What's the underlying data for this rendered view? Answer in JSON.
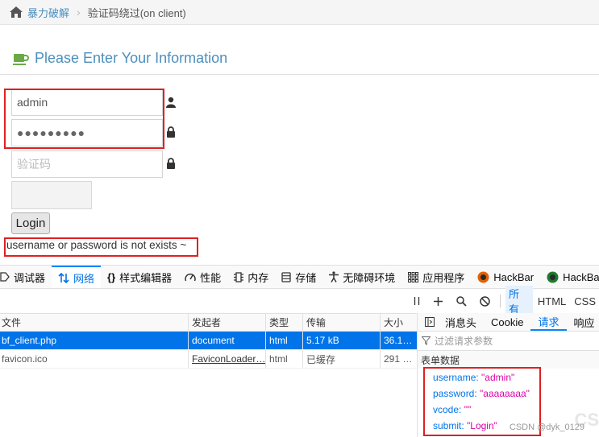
{
  "breadcrumb": {
    "home": "暴力破解",
    "current": "验证码绕过(on client)"
  },
  "form": {
    "title": "Please Enter Your Information",
    "username_value": "admin",
    "password_value": "●●●●●●●●●",
    "vcode_placeholder": "验证码",
    "login_label": "Login",
    "message": "username or password is not exists ~"
  },
  "devtools": {
    "tabs": [
      {
        "label": "调试器",
        "icon": "debugger-icon"
      },
      {
        "label": "网络",
        "icon": "network-icon",
        "active": true
      },
      {
        "label": "样式编辑器",
        "icon": "style-editor-icon"
      },
      {
        "label": "性能",
        "icon": "performance-icon"
      },
      {
        "label": "内存",
        "icon": "memory-icon"
      },
      {
        "label": "存储",
        "icon": "storage-icon"
      },
      {
        "label": "无障碍环境",
        "icon": "accessibility-icon"
      },
      {
        "label": "应用程序",
        "icon": "application-icon"
      },
      {
        "label": "HackBar",
        "icon": "hackbar-icon"
      },
      {
        "label": "HackBar",
        "icon": "hackbar-icon"
      }
    ],
    "filters": {
      "all": "所有",
      "html": "HTML",
      "css": "CSS"
    },
    "columns": [
      "文件",
      "发起者",
      "类型",
      "传输",
      "大小"
    ],
    "requests": [
      {
        "file": "bf_client.php",
        "initiator": "document",
        "type": "html",
        "transfer": "5.17 kB",
        "size": "36.1…",
        "selected": true
      },
      {
        "file": "favicon.ico",
        "initiator": "FaviconLoader…",
        "type": "html",
        "transfer": "已缓存",
        "size": "291 …",
        "selected": false
      }
    ],
    "panel_tabs": {
      "headers": "消息头",
      "cookie": "Cookie",
      "request": "请求",
      "response": "响应"
    },
    "filter_params_placeholder": "过滤请求参数",
    "form_data_label": "表单数据",
    "form_data": [
      {
        "key": "username",
        "value": "\"admin\""
      },
      {
        "key": "password",
        "value": "\"aaaaaaaa\""
      },
      {
        "key": "vcode",
        "value": "\"\""
      },
      {
        "key": "submit",
        "value": "\"Login\""
      }
    ]
  },
  "watermark": "CSDN @dyk_0129",
  "ghost_text": "CS",
  "colors": {
    "link_blue": "#4c8fbd",
    "highlight_red": "#e02020",
    "selected_row": "#0074e8",
    "value_magenta": "#dd00a9"
  }
}
